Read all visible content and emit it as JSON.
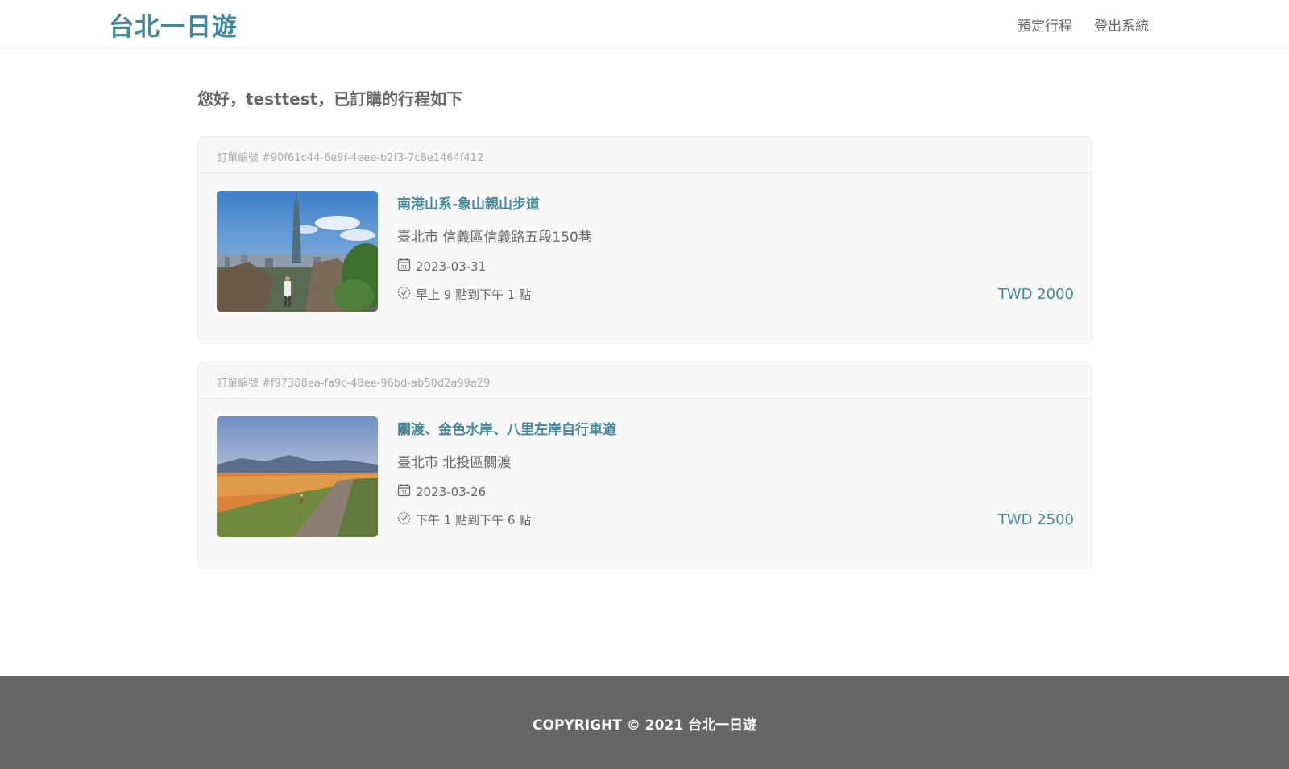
{
  "header": {
    "brand": "台北一日遊",
    "nav": [
      "預定行程",
      "登出系統"
    ]
  },
  "greeting": "您好，testtest，已訂購的行程如下",
  "orders": [
    {
      "order_label": "訂單編號",
      "order_id": "#90f61c44-6e9f-4eee-b2f3-7c8e1464f412",
      "attraction": "南港山系-象山親山步道",
      "address": "臺北市 信義區信義路五段150巷",
      "date": "2023-03-31",
      "time": "早上 9 點到下午 1 點",
      "price": "TWD 2000"
    },
    {
      "order_label": "訂單編號",
      "order_id": "#f97388ea-fa9c-48ee-96bd-ab50d2a99a29",
      "attraction": "關渡、金色水岸、八里左岸自行車道",
      "address": "臺北市 北投區關渡",
      "date": "2023-03-26",
      "time": "下午 1 點到下午 6 點",
      "price": "TWD 2500"
    }
  ],
  "footer": {
    "copyright": "COPYRIGHT © 2021 台北一日遊"
  },
  "colors": {
    "accent": "#448899",
    "text": "#666666",
    "card_bg": "#f8f8f8",
    "footer_bg": "#666666"
  },
  "icons": [
    "calendar-icon",
    "clock-icon"
  ]
}
